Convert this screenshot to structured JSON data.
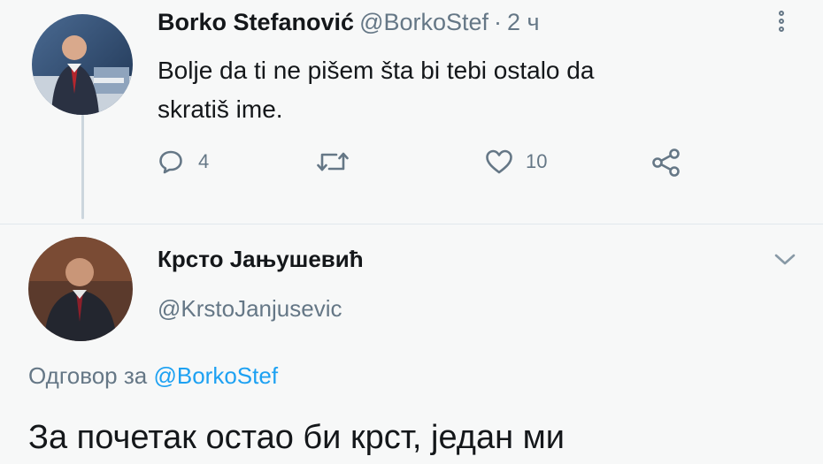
{
  "tweet1": {
    "display_name": "Borko Stefanović",
    "handle": "@BorkoStef",
    "separator": "·",
    "time": "2 ч",
    "text_line1": "Bolje da ti ne pišem šta bi tebi ostalo da",
    "text_line2": "skratiš ime.",
    "reply_count": "4",
    "like_count": "10",
    "avatar_icon": "profile-photo",
    "menu_icon": "more-vertical-icon"
  },
  "tweet2": {
    "display_name": "Крсто Јањушевић",
    "handle": "@KrstoJanjusevic",
    "reply_prefix": "Одговор за",
    "reply_mention": "@BorkoStef",
    "text": "За почетак остао би крст, један ми",
    "avatar_icon": "profile-photo",
    "menu_icon": "chevron-down-icon"
  },
  "colors": {
    "background": "#f7f8f8",
    "text": "#14171a",
    "secondary_text": "#657786",
    "mention": "#1da1f2",
    "thread_line": "#ccd6dd"
  }
}
